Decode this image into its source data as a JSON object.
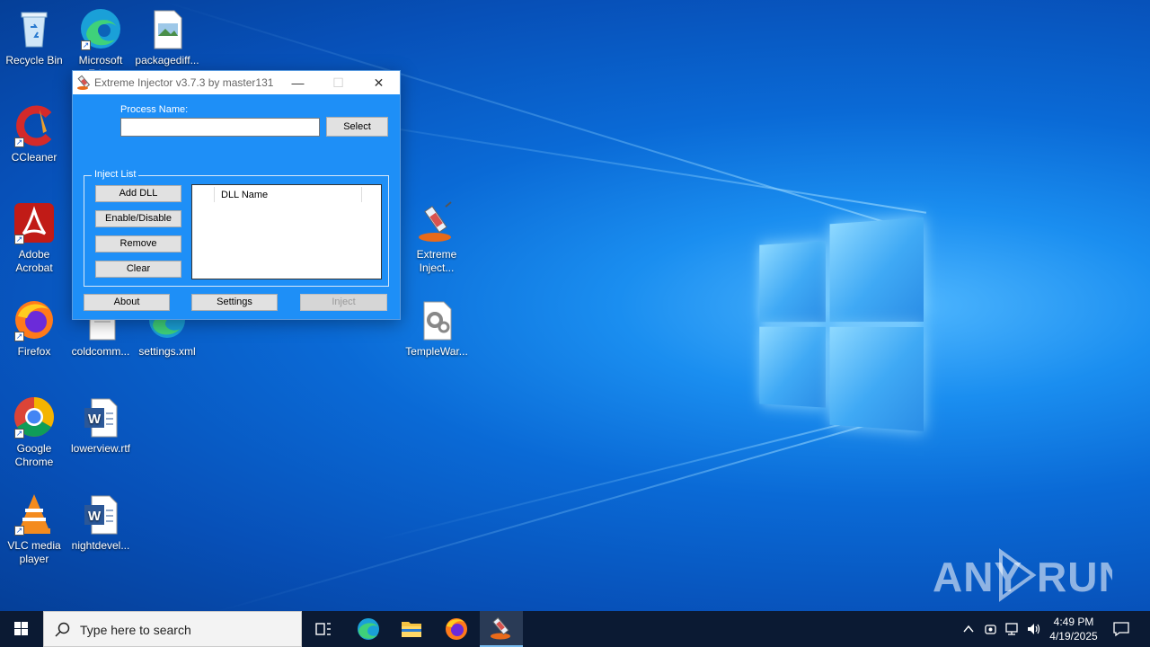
{
  "desktop": {
    "icons": [
      {
        "label": "Recycle Bin",
        "icon": "recycle-bin-icon"
      },
      {
        "label": "Microsoft Edge",
        "icon": "edge-icon"
      },
      {
        "label": "packagediff...",
        "icon": "image-file-icon"
      },
      {
        "label": "CCleaner",
        "icon": "ccleaner-icon"
      },
      {
        "label": "Adobe Acrobat",
        "icon": "acrobat-icon"
      },
      {
        "label": "Extreme Inject...",
        "icon": "syringe-icon"
      },
      {
        "label": "Firefox",
        "icon": "firefox-icon"
      },
      {
        "label": "coldcomm...",
        "icon": "document-icon"
      },
      {
        "label": "settings.xml",
        "icon": "edge-xml-icon"
      },
      {
        "label": "TempleWar...",
        "icon": "settings-file-icon"
      },
      {
        "label": "Google Chrome",
        "icon": "chrome-icon"
      },
      {
        "label": "lowerview.rtf",
        "icon": "word-doc-icon"
      },
      {
        "label": "VLC media player",
        "icon": "vlc-icon"
      },
      {
        "label": "nightdevel...",
        "icon": "word-doc-icon"
      }
    ]
  },
  "window": {
    "title": "Extreme Injector v3.7.3 by master131",
    "minimize": "—",
    "maximize": "☐",
    "close": "✕",
    "process_label": "Process Name:",
    "process_value": "",
    "select_button": "Select",
    "inject_list_label": "Inject List",
    "add_dll_button": "Add DLL",
    "enable_disable_button": "Enable/Disable",
    "remove_button": "Remove",
    "clear_button": "Clear",
    "dll_column": "DLL Name",
    "about_button": "About",
    "settings_button": "Settings",
    "inject_button": "Inject"
  },
  "watermark": "ANY RUN",
  "taskbar": {
    "search_placeholder": "Type here to search",
    "time": "4:49 PM",
    "date": "4/19/2025"
  },
  "colors": {
    "window_bg": "#1e8ff7",
    "taskbar_bg": "#0b1a33"
  }
}
